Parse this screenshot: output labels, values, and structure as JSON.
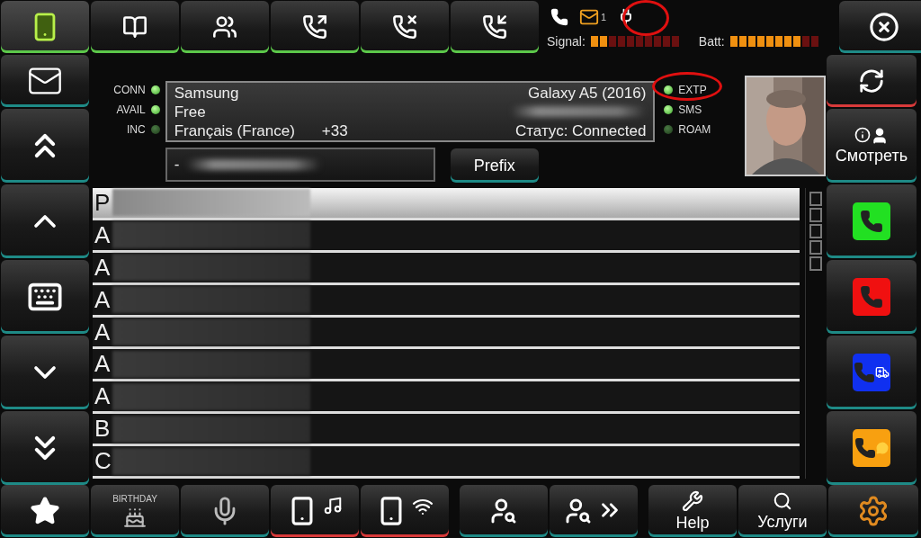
{
  "top_tabs": [
    {
      "selected": true,
      "on": true
    },
    {
      "selected": false,
      "on": true
    },
    {
      "selected": false,
      "on": true
    },
    {
      "selected": false,
      "on": true
    },
    {
      "selected": false,
      "on": true
    },
    {
      "selected": false,
      "on": true
    }
  ],
  "status": {
    "mail_count": "1",
    "signal": {
      "label": "Signal:",
      "level": 0.2
    },
    "battery": {
      "label": "Batt:",
      "level": 0.8
    }
  },
  "left_indicators": [
    {
      "label": "CONN",
      "on": true
    },
    {
      "label": "AVAIL",
      "on": true
    },
    {
      "label": "INC",
      "on": false
    }
  ],
  "device": {
    "brand": "Samsung",
    "model": "Galaxy A5 (2016)",
    "operator": "Free",
    "language": "Français (France)",
    "country_code": "+33",
    "status": "Статус: Connected"
  },
  "right_indicators": [
    {
      "label": "EXTP",
      "on": true
    },
    {
      "label": "SMS",
      "on": true
    },
    {
      "label": "ROAM",
      "on": false
    }
  ],
  "dial": {
    "value": "-"
  },
  "prefix_button": "Prefix",
  "contacts": [
    {
      "initial": "P",
      "selected": true
    },
    {
      "initial": "A",
      "selected": false
    },
    {
      "initial": "A",
      "selected": false
    },
    {
      "initial": "A",
      "selected": false
    },
    {
      "initial": "A",
      "selected": false
    },
    {
      "initial": "A",
      "selected": false
    },
    {
      "initial": "A",
      "selected": false
    },
    {
      "initial": "B",
      "selected": false
    },
    {
      "initial": "C",
      "selected": false
    }
  ],
  "right_buttons": {
    "sync_alert": true,
    "view_label": "Смотреть"
  },
  "bottom_bar": [
    {
      "kind": "star",
      "alert": false
    },
    {
      "kind": "birthday",
      "label": "BIRTHDAY",
      "alert": false
    },
    {
      "kind": "mic",
      "alert": false
    },
    {
      "kind": "phone-music",
      "alert": true
    },
    {
      "kind": "phone-wifi",
      "alert": true
    },
    {
      "kind": "search-contact",
      "alert": false
    },
    {
      "kind": "search-next",
      "alert": false
    },
    {
      "kind": "help",
      "label": "Help",
      "alert": false
    },
    {
      "kind": "services",
      "label": "Услуги",
      "alert": false
    },
    {
      "kind": "settings",
      "alert": false
    }
  ]
}
